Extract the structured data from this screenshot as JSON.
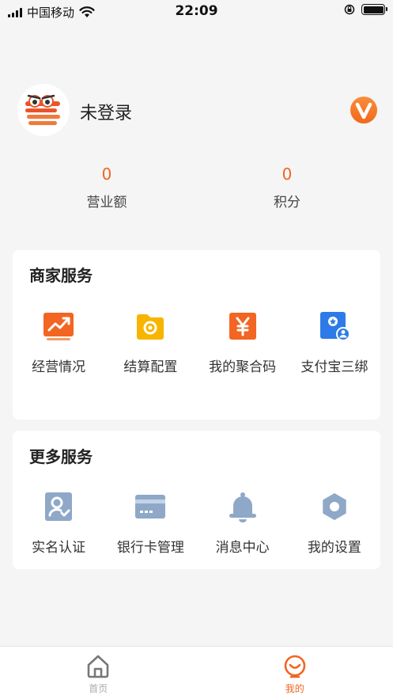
{
  "status_bar": {
    "carrier": "中国移动",
    "time": "22:09"
  },
  "profile": {
    "username": "未登录",
    "vip_icon": "vip-badge-icon"
  },
  "stats": [
    {
      "value": "0",
      "label": "营业额"
    },
    {
      "value": "0",
      "label": "积分"
    }
  ],
  "merchant_services": {
    "title": "商家服务",
    "items": [
      {
        "label": "经营情况",
        "icon": "trend-chart-icon"
      },
      {
        "label": "结算配置",
        "icon": "folder-settings-icon"
      },
      {
        "label": "我的聚合码",
        "icon": "yuan-code-icon"
      },
      {
        "label": "支付宝三绑",
        "icon": "alipay-bind-icon"
      }
    ]
  },
  "more_services": {
    "title": "更多服务",
    "items": [
      {
        "label": "实名认证",
        "icon": "id-verify-icon"
      },
      {
        "label": "银行卡管理",
        "icon": "bank-card-icon"
      },
      {
        "label": "消息中心",
        "icon": "bell-icon"
      },
      {
        "label": "我的设置",
        "icon": "gear-icon"
      }
    ]
  },
  "tabbar": {
    "items": [
      {
        "label": "首页",
        "icon": "home-icon",
        "active": false
      },
      {
        "label": "我的",
        "icon": "mine-icon",
        "active": true
      }
    ]
  },
  "colors": {
    "accent": "#f26522",
    "blue_icon": "#2e7be8",
    "muted_icon": "#8fa8c8"
  }
}
